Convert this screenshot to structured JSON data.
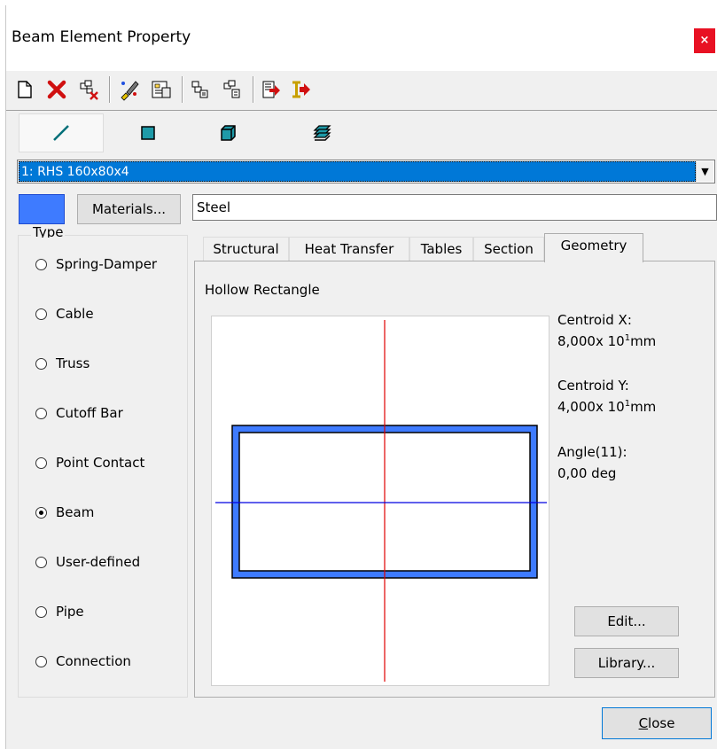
{
  "window": {
    "title": "Beam Element Property",
    "close_glyph": "×"
  },
  "toolbar": {
    "icons": [
      {
        "name": "new-icon",
        "glyph": "🗋"
      },
      {
        "name": "delete-icon",
        "glyph": "✖"
      },
      {
        "name": "delete-element-icon",
        "glyph": "⧉"
      },
      {
        "name": "edit-brush-icon",
        "glyph": "✎"
      },
      {
        "name": "properties-icon",
        "glyph": "☶"
      },
      {
        "name": "copy-icon",
        "glyph": "⧉"
      },
      {
        "name": "paste-icon",
        "glyph": "⧉"
      },
      {
        "name": "export-icon",
        "glyph": "▶"
      },
      {
        "name": "export-beam-icon",
        "glyph": "▶"
      }
    ]
  },
  "element": {
    "selected": "1: RHS 160x80x4",
    "color": "#3e7bff",
    "materials_button": "Materials...",
    "material_name": "Steel"
  },
  "type_group": {
    "label": "Type",
    "options": [
      {
        "label": "Spring-Damper",
        "checked": false
      },
      {
        "label": "Cable",
        "checked": false
      },
      {
        "label": "Truss",
        "checked": false
      },
      {
        "label": "Cutoff Bar",
        "checked": false
      },
      {
        "label": "Point Contact",
        "checked": false
      },
      {
        "label": "Beam",
        "checked": true
      },
      {
        "label": "User-defined",
        "checked": false
      },
      {
        "label": "Pipe",
        "checked": false
      },
      {
        "label": "Connection",
        "checked": false
      }
    ]
  },
  "tabs": [
    "Structural",
    "Heat Transfer",
    "Tables",
    "Section",
    "Geometry"
  ],
  "active_tab": "Geometry",
  "geometry": {
    "shape_name": "Hollow Rectangle",
    "centroid_x_label": "Centroid X:",
    "centroid_x_mantissa": "8,000x 10",
    "centroid_x_exp": "1",
    "centroid_x_unit": "mm",
    "centroid_y_label": "Centroid Y:",
    "centroid_y_mantissa": "4,000x 10",
    "centroid_y_exp": "1",
    "centroid_y_unit": "mm",
    "angle_label": "Angle(11):",
    "angle_value": "0,00 deg",
    "edit_button": "Edit...",
    "library_button": "Library...",
    "section_color": "#3e7bff",
    "axis1_color": "#e00000",
    "axis2_color": "#0000e0"
  },
  "footer": {
    "close_button": "Close",
    "close_mnemonic": "C",
    "close_rest": "lose"
  }
}
